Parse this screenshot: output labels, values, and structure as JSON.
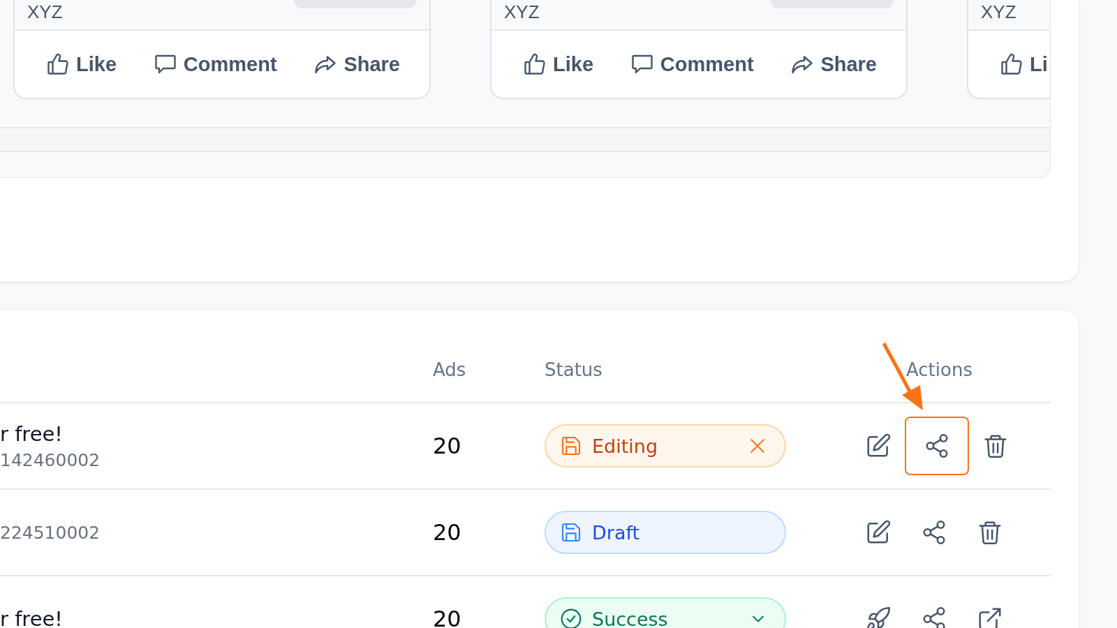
{
  "feed_cards": [
    {
      "author": "XYZ",
      "actions": [
        {
          "kind": "like",
          "label": "Like"
        },
        {
          "kind": "comment",
          "label": "Comment"
        },
        {
          "kind": "share",
          "label": "Share"
        }
      ]
    },
    {
      "author": "XYZ",
      "actions": [
        {
          "kind": "like",
          "label": "Like"
        },
        {
          "kind": "comment",
          "label": "Comment"
        },
        {
          "kind": "share",
          "label": "Share"
        }
      ]
    },
    {
      "author": "XYZ",
      "actions": [
        {
          "kind": "like",
          "label": "Li"
        }
      ]
    }
  ],
  "table": {
    "columns": [
      "Ads",
      "Status",
      "Actions"
    ],
    "rows": [
      {
        "title": "r free!",
        "subtitle": "142460002",
        "ads": "20",
        "status": {
          "kind": "editing",
          "label": "Editing",
          "control": {
            "kind": "clear"
          }
        },
        "actions": [
          {
            "kind": "edit",
            "highlighted": false
          },
          {
            "kind": "share",
            "highlighted": true
          },
          {
            "kind": "delete",
            "highlighted": false
          }
        ]
      },
      {
        "subtitle": "224510002",
        "ads": "20",
        "status": {
          "kind": "draft",
          "label": "Draft"
        },
        "actions": [
          {
            "kind": "edit",
            "highlighted": false
          },
          {
            "kind": "share",
            "highlighted": false
          },
          {
            "kind": "delete",
            "highlighted": false
          }
        ]
      },
      {
        "title": "r free!",
        "ads": "20",
        "status": {
          "kind": "success",
          "label": "Success",
          "control": {
            "kind": "dropdown"
          }
        },
        "actions": [
          {
            "kind": "launch",
            "highlighted": false
          },
          {
            "kind": "share",
            "highlighted": false
          },
          {
            "kind": "open",
            "highlighted": false
          }
        ]
      }
    ]
  }
}
